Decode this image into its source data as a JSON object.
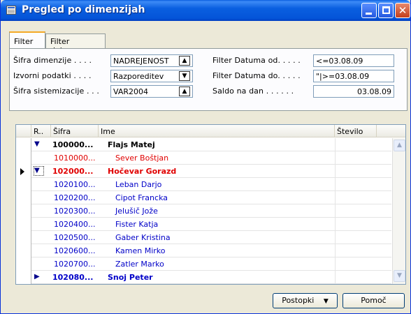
{
  "window": {
    "title": "Pregled po dimenzijah"
  },
  "tabs": [
    {
      "label": "Filter"
    },
    {
      "label": "Filter delavca"
    }
  ],
  "filters": {
    "dim_label": "Šifra dimenzije . . . .",
    "dim_value": "NADREJENOST",
    "source_label": "Izvorni podatki . . . .",
    "source_value": "Razporeditev",
    "sys_label": "Šifra sistemizacije . . .",
    "sys_value": "VAR2004",
    "date_from_label": "Filter Datuma od. . . . .",
    "date_from_value": "<=03.08.09",
    "date_to_label": "Filter Datuma do. . . . .",
    "date_to_value": "\"|>=03.08.09",
    "balance_label": "Saldo na dan . . . . . .",
    "balance_value": "03.08.09"
  },
  "grid": {
    "columns": [
      {
        "label": "R.."
      },
      {
        "label": "Šifra"
      },
      {
        "label": "Ime"
      },
      {
        "label": "Število"
      }
    ],
    "rows": [
      {
        "code": "100000...",
        "name": "Flajs Matej",
        "color": "#000000"
      },
      {
        "code": "1010000...",
        "name": "Sever Boštjan",
        "color": "#e00000"
      },
      {
        "code": "102000...",
        "name": "Hočevar Gorazd",
        "color": "#e00000"
      },
      {
        "code": "1020100...",
        "name": "Leban Darjo",
        "color": "#0000c8"
      },
      {
        "code": "1020200...",
        "name": "Cipot Francka",
        "color": "#0000c8"
      },
      {
        "code": "1020300...",
        "name": "Jelušič Jože",
        "color": "#0000c8"
      },
      {
        "code": "1020400...",
        "name": "Fister Katja",
        "color": "#0000c8"
      },
      {
        "code": "1020500...",
        "name": "Gaber Kristina",
        "color": "#0000c8"
      },
      {
        "code": "1020600...",
        "name": "Kamen Mirko",
        "color": "#0000c8"
      },
      {
        "code": "1020700...",
        "name": "Zatler Marko",
        "color": "#0000c8"
      },
      {
        "code": "102080...",
        "name": "Snoj Peter",
        "color": "#0000c8"
      }
    ]
  },
  "buttons": {
    "actions": "Postopki",
    "help": "Pomoč"
  }
}
